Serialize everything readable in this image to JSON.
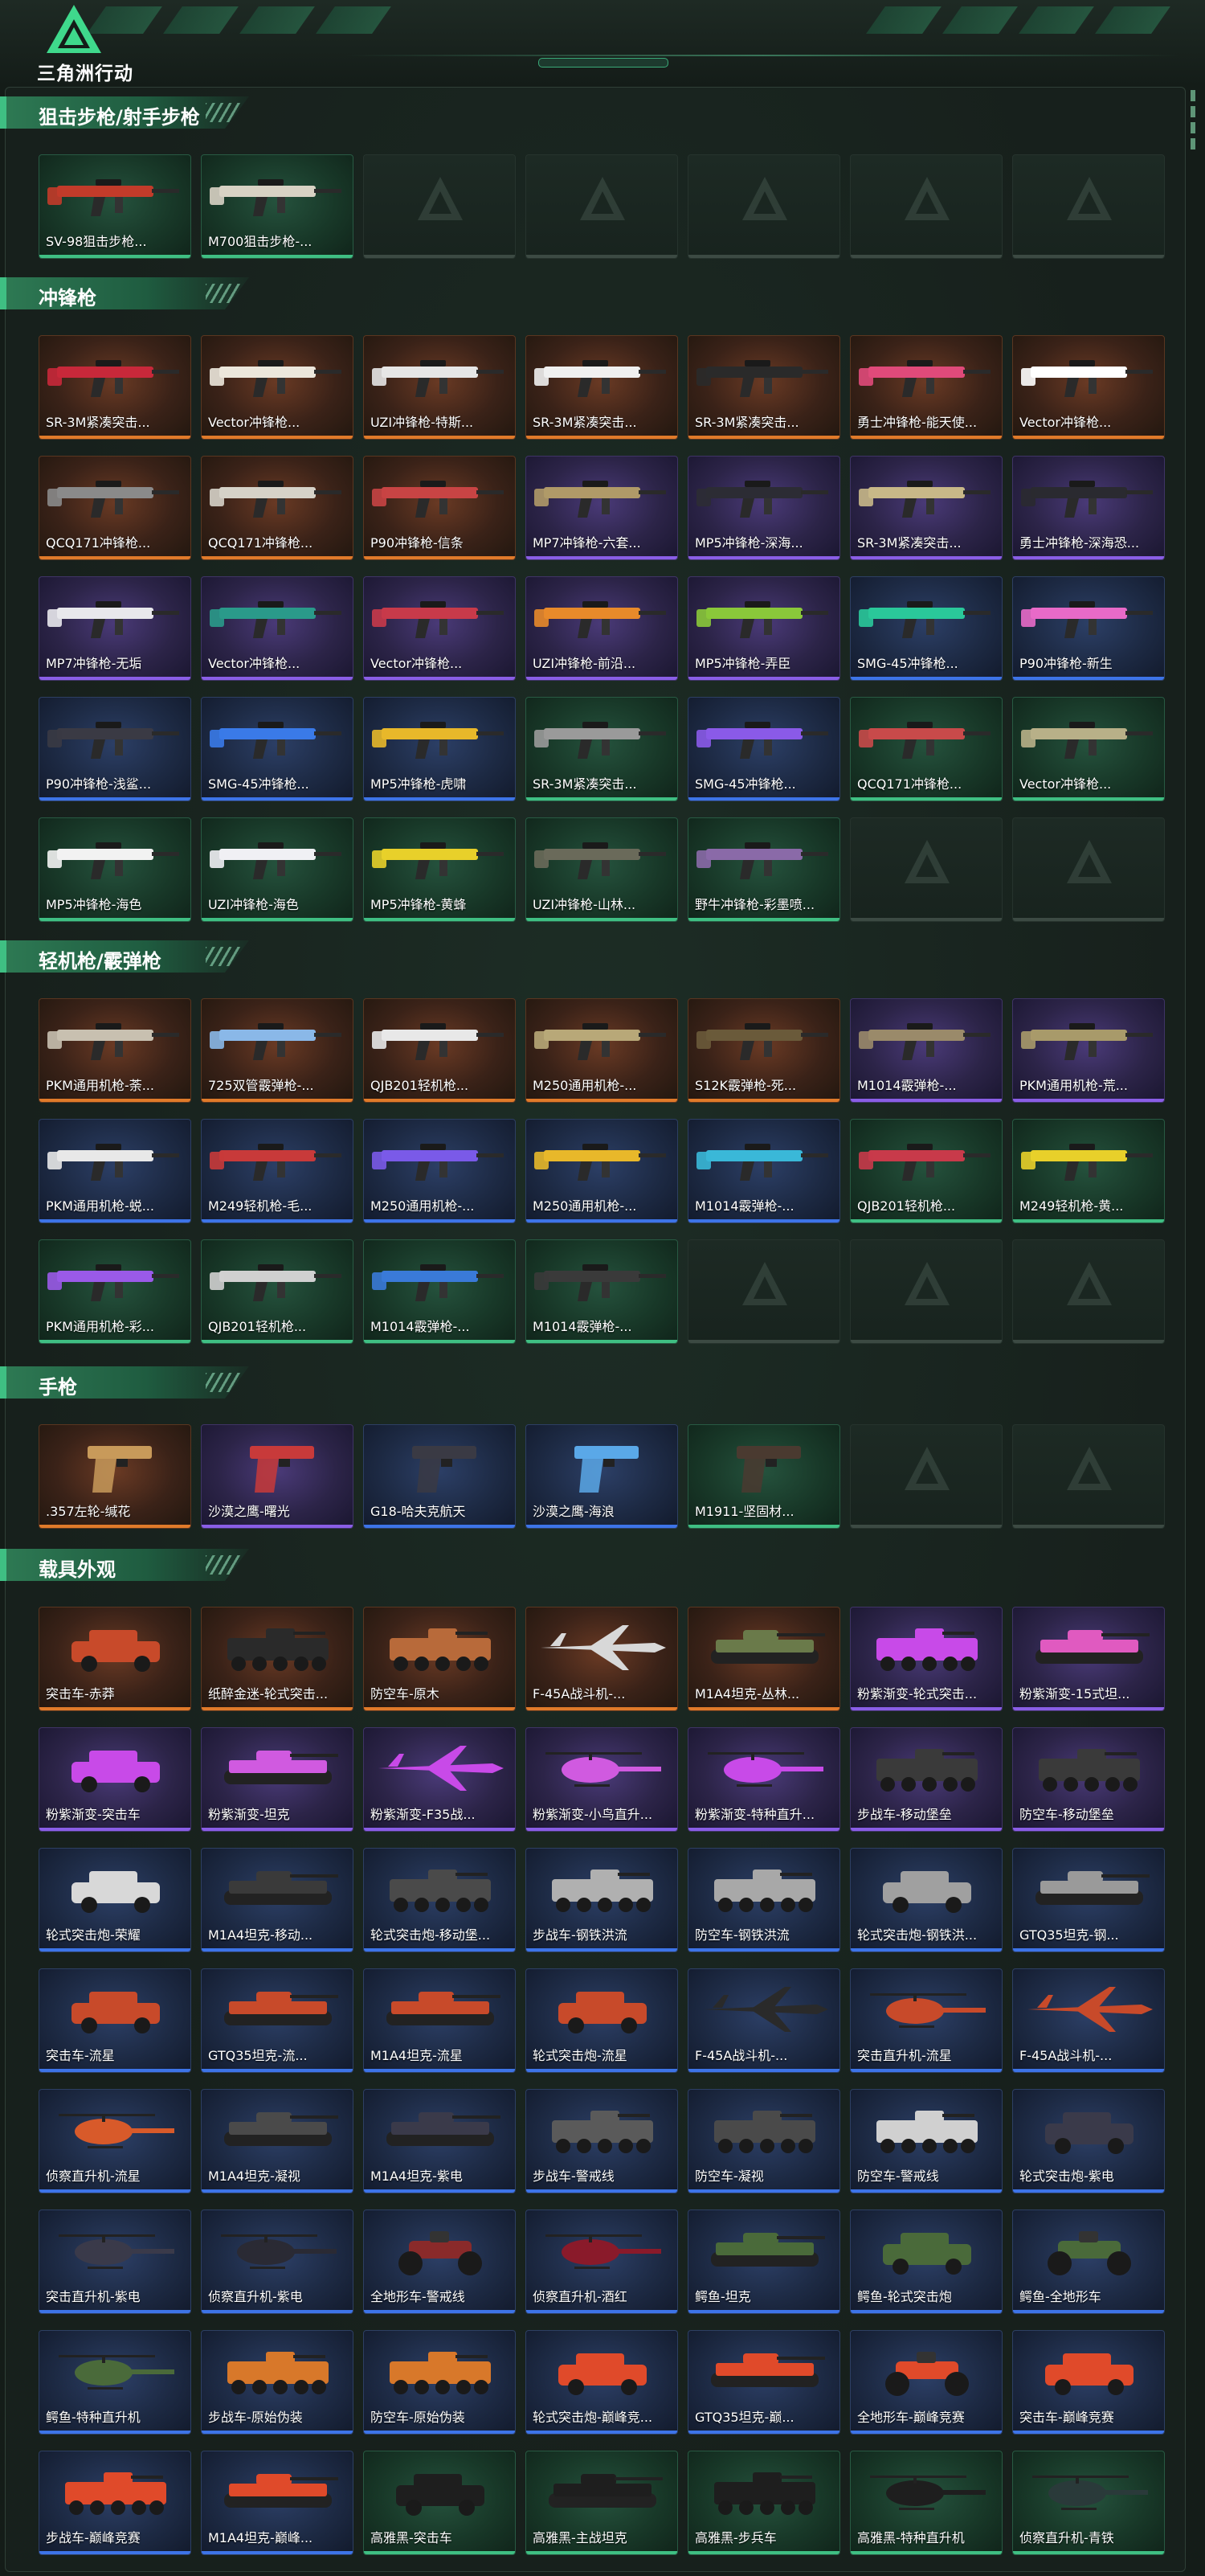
{
  "app": {
    "title": "三角洲行动"
  },
  "colors": {
    "orange": "#e07a2a",
    "purple": "#8a5ee6",
    "blue": "#3d74e8",
    "green": "#3fbf83",
    "accent": "#2e7a54",
    "background": "#141c18"
  },
  "sections": [
    {
      "title": "狙击步枪/射手步枪",
      "kind": "gun",
      "rows": 1,
      "items": [
        {
          "name": "SV-98狙击步枪...",
          "rarity": "green",
          "color": "#c23b2a"
        },
        {
          "name": "M700狙击步枪-...",
          "rarity": "green",
          "color": "#d8d2c4"
        },
        null,
        null,
        null,
        null,
        null
      ]
    },
    {
      "title": "冲锋枪",
      "kind": "gun",
      "rows": 5,
      "items": [
        {
          "name": "SR-3M紧凑突击...",
          "rarity": "orange",
          "color": "#c8283a"
        },
        {
          "name": "Vector冲锋枪...",
          "rarity": "orange",
          "color": "#ece7dc"
        },
        {
          "name": "UZI冲锋枪-特斯...",
          "rarity": "orange",
          "color": "#e6e6e6"
        },
        {
          "name": "SR-3M紧凑突击...",
          "rarity": "orange",
          "color": "#f0f0f0"
        },
        {
          "name": "SR-3M紧凑突击...",
          "rarity": "orange",
          "color": "#2a2a2a"
        },
        {
          "name": "勇士冲锋枪-能天使...",
          "rarity": "orange",
          "color": "#e04a7a"
        },
        {
          "name": "Vector冲锋枪...",
          "rarity": "orange",
          "color": "#ffffff"
        },
        {
          "name": "QCQ171冲锋枪...",
          "rarity": "orange",
          "color": "#8a8a8a"
        },
        {
          "name": "QCQ171冲锋枪...",
          "rarity": "orange",
          "color": "#d6d2c8"
        },
        {
          "name": "P90冲锋枪-信条",
          "rarity": "orange",
          "color": "#c84444"
        },
        {
          "name": "MP7冲锋枪-六套...",
          "rarity": "purple",
          "color": "#b09a68"
        },
        {
          "name": "MP5冲锋枪-深海...",
          "rarity": "purple",
          "color": "#2c2c34"
        },
        {
          "name": "SR-3M紧凑突击...",
          "rarity": "purple",
          "color": "#c8b888"
        },
        {
          "name": "勇士冲锋枪-深海恐...",
          "rarity": "purple",
          "color": "#2a2a30"
        },
        {
          "name": "MP7冲锋枪-无垢",
          "rarity": "purple",
          "color": "#e8e8ec"
        },
        {
          "name": "Vector冲锋枪...",
          "rarity": "purple",
          "color": "#2a9a8a"
        },
        {
          "name": "Vector冲锋枪...",
          "rarity": "purple",
          "color": "#c83a4a"
        },
        {
          "name": "UZI冲锋枪-前沿...",
          "rarity": "purple",
          "color": "#e88a2a"
        },
        {
          "name": "MP5冲锋枪-弄臣",
          "rarity": "purple",
          "color": "#8ac83a"
        },
        {
          "name": "SMG-45冲锋枪...",
          "rarity": "blue",
          "color": "#2ac89a"
        },
        {
          "name": "P90冲锋枪-新生",
          "rarity": "blue",
          "color": "#e86ac8"
        },
        {
          "name": "P90冲锋枪-浅鲨...",
          "rarity": "blue",
          "color": "#3a3a44"
        },
        {
          "name": "SMG-45冲锋枪...",
          "rarity": "blue",
          "color": "#3a7ae8"
        },
        {
          "name": "MP5冲锋枪-虎啸",
          "rarity": "blue",
          "color": "#e8b82a"
        },
        {
          "name": "SR-3M紧凑突击...",
          "rarity": "green",
          "color": "#9a9a9a"
        },
        {
          "name": "SMG-45冲锋枪...",
          "rarity": "blue",
          "color": "#8a5ae8"
        },
        {
          "name": "QCQ171冲锋枪...",
          "rarity": "green",
          "color": "#c84a4a"
        },
        {
          "name": "Vector冲锋枪...",
          "rarity": "green",
          "color": "#b8b088"
        },
        {
          "name": "MP5冲锋枪-海色",
          "rarity": "green",
          "color": "#f2f2f2"
        },
        {
          "name": "UZI冲锋枪-海色",
          "rarity": "green",
          "color": "#f0f0f4"
        },
        {
          "name": "MP5冲锋枪-黄蜂",
          "rarity": "green",
          "color": "#e8d02a"
        },
        {
          "name": "UZI冲锋枪-山林...",
          "rarity": "green",
          "color": "#6a6a5a"
        },
        {
          "name": "野牛冲锋枪-彩墨喷...",
          "rarity": "green",
          "color": "#8a6aa8"
        },
        null,
        null
      ]
    },
    {
      "title": "轻机枪/霰弹枪",
      "kind": "gun",
      "rows": 3,
      "items": [
        {
          "name": "PKM通用机枪-荼...",
          "rarity": "orange",
          "color": "#c8c0b0"
        },
        {
          "name": "725双管霰弹枪-...",
          "rarity": "orange",
          "color": "#8ab8e8"
        },
        {
          "name": "QJB201轻机枪...",
          "rarity": "orange",
          "color": "#e8e8e8"
        },
        {
          "name": "M250通用机枪-...",
          "rarity": "orange",
          "color": "#b8a878"
        },
        {
          "name": "S12K霰弹枪-死...",
          "rarity": "orange",
          "color": "#6a5a3a"
        },
        {
          "name": "M1014霰弹枪-...",
          "rarity": "purple",
          "color": "#9a8a6a"
        },
        {
          "name": "PKM通用机枪-荒...",
          "rarity": "purple",
          "color": "#a89a6a"
        },
        {
          "name": "PKM通用机枪-蜕...",
          "rarity": "blue",
          "color": "#e8e8e8"
        },
        {
          "name": "M249轻机枪-毛...",
          "rarity": "blue",
          "color": "#c83a3a"
        },
        {
          "name": "M250通用机枪-...",
          "rarity": "blue",
          "color": "#7a5ae8"
        },
        {
          "name": "M250通用机枪-...",
          "rarity": "blue",
          "color": "#e8b82a"
        },
        {
          "name": "M1014霰弹枪-...",
          "rarity": "blue",
          "color": "#3ab8d8"
        },
        {
          "name": "QJB201轻机枪...",
          "rarity": "green",
          "color": "#c83a4a"
        },
        {
          "name": "M249轻机枪-黄...",
          "rarity": "green",
          "color": "#e8d02a"
        },
        {
          "name": "PKM通用机枪-彩...",
          "rarity": "green",
          "color": "#9a5ae8"
        },
        {
          "name": "QJB201轻机枪...",
          "rarity": "green",
          "color": "#d0d0d0"
        },
        {
          "name": "M1014霰弹枪-...",
          "rarity": "green",
          "color": "#3a7ad8"
        },
        {
          "name": "M1014霰弹枪-...",
          "rarity": "green",
          "color": "#3a3a3a"
        },
        null,
        null,
        null
      ]
    },
    {
      "title": "手枪",
      "kind": "pistol",
      "rows": 1,
      "items": [
        {
          "name": ".357左轮-缄花",
          "rarity": "orange",
          "color": "#c89a5a"
        },
        {
          "name": "沙漠之鹰-曙光",
          "rarity": "purple",
          "color": "#c83a3a"
        },
        {
          "name": "G18-哈夫克航天",
          "rarity": "blue",
          "color": "#3a3a44"
        },
        {
          "name": "沙漠之鹰-海浪",
          "rarity": "blue",
          "color": "#5aa8e8"
        },
        {
          "name": "M1911-坚固材...",
          "rarity": "green",
          "color": "#4a3a30"
        },
        null,
        null
      ]
    },
    {
      "title": "载具外观",
      "kind": "vehicle",
      "rows": 8,
      "items": [
        {
          "name": "突击车-赤莽",
          "rarity": "orange",
          "color": "#c84a2a",
          "v": "car"
        },
        {
          "name": "纸醉金迷-轮式突击...",
          "rarity": "orange",
          "color": "#2a2a2a",
          "v": "apc"
        },
        {
          "name": "防空车-原木",
          "rarity": "orange",
          "color": "#b86a3a",
          "v": "apc"
        },
        {
          "name": "F-45A战斗机-...",
          "rarity": "orange",
          "color": "#d8d8d8",
          "v": "jet"
        },
        {
          "name": "M1A4坦克-丛林...",
          "rarity": "orange",
          "color": "#6a7a4a",
          "v": "tank"
        },
        {
          "name": "粉紫渐变-轮式突击...",
          "rarity": "purple",
          "color": "#c84ae8",
          "v": "apc"
        },
        {
          "name": "粉紫渐变-15式坦...",
          "rarity": "purple",
          "color": "#e05ac0",
          "v": "tank"
        },
        {
          "name": "粉紫渐变-突击车",
          "rarity": "purple",
          "color": "#c84ae8",
          "v": "car"
        },
        {
          "name": "粉紫渐变-坦克",
          "rarity": "purple",
          "color": "#d05ae0",
          "v": "tank"
        },
        {
          "name": "粉紫渐变-F35战...",
          "rarity": "purple",
          "color": "#c84ae8",
          "v": "jet"
        },
        {
          "name": "粉紫渐变-小鸟直升...",
          "rarity": "purple",
          "color": "#d05ae0",
          "v": "heli"
        },
        {
          "name": "粉紫渐变-特种直升...",
          "rarity": "purple",
          "color": "#c84ae8",
          "v": "heli"
        },
        {
          "name": "步战车-移动堡垒",
          "rarity": "purple",
          "color": "#3a3a3a",
          "v": "apc"
        },
        {
          "name": "防空车-移动堡垒",
          "rarity": "purple",
          "color": "#3a3a3a",
          "v": "apc"
        },
        {
          "name": "轮式突击炮-荣耀",
          "rarity": "blue",
          "color": "#d8d8d8",
          "v": "car"
        },
        {
          "name": "M1A4坦克-移动...",
          "rarity": "blue",
          "color": "#3a3a3a",
          "v": "tank"
        },
        {
          "name": "轮式突击炮-移动堡...",
          "rarity": "blue",
          "color": "#4a4a4a",
          "v": "apc"
        },
        {
          "name": "步战车-钢铁洪流",
          "rarity": "blue",
          "color": "#b0b0b0",
          "v": "apc"
        },
        {
          "name": "防空车-钢铁洪流",
          "rarity": "blue",
          "color": "#a8a8a8",
          "v": "apc"
        },
        {
          "name": "轮式突击炮-钢铁洪...",
          "rarity": "blue",
          "color": "#a0a0a0",
          "v": "car"
        },
        {
          "name": "GTQ35坦克-钢...",
          "rarity": "blue",
          "color": "#9a9a9a",
          "v": "tank"
        },
        {
          "name": "突击车-流星",
          "rarity": "blue",
          "color": "#c84a2a",
          "v": "car"
        },
        {
          "name": "GTQ35坦克-流...",
          "rarity": "blue",
          "color": "#c84a2a",
          "v": "tank"
        },
        {
          "name": "M1A4坦克-流星",
          "rarity": "blue",
          "color": "#c84a2a",
          "v": "tank"
        },
        {
          "name": "轮式突击炮-流星",
          "rarity": "blue",
          "color": "#c84a2a",
          "v": "car"
        },
        {
          "name": "F-45A战斗机-...",
          "rarity": "blue",
          "color": "#2a2a2a",
          "v": "jet"
        },
        {
          "name": "突击直升机-流星",
          "rarity": "blue",
          "color": "#c84a2a",
          "v": "heli"
        },
        {
          "name": "F-45A战斗机-...",
          "rarity": "blue",
          "color": "#c84a2a",
          "v": "jet"
        },
        {
          "name": "侦察直升机-流星",
          "rarity": "blue",
          "color": "#d85a2a",
          "v": "heli"
        },
        {
          "name": "M1A4坦克-凝视",
          "rarity": "blue",
          "color": "#4a4a4a",
          "v": "tank"
        },
        {
          "name": "M1A4坦克-紫电",
          "rarity": "blue",
          "color": "#3a3a4a",
          "v": "tank"
        },
        {
          "name": "步战车-警戒线",
          "rarity": "blue",
          "color": "#5a5a5a",
          "v": "apc"
        },
        {
          "name": "防空车-凝视",
          "rarity": "blue",
          "color": "#4a4a4a",
          "v": "apc"
        },
        {
          "name": "防空车-警戒线",
          "rarity": "blue",
          "color": "#d0d0d0",
          "v": "apc"
        },
        {
          "name": "轮式突击炮-紫电",
          "rarity": "blue",
          "color": "#3a3a4a",
          "v": "car"
        },
        {
          "name": "突击直升机-紫电",
          "rarity": "blue",
          "color": "#3a3a4a",
          "v": "heli"
        },
        {
          "name": "侦察直升机-紫电",
          "rarity": "blue",
          "color": "#2a2a34",
          "v": "heli"
        },
        {
          "name": "全地形车-警戒线",
          "rarity": "blue",
          "color": "#8a2a2a",
          "v": "atv"
        },
        {
          "name": "侦察直升机-酒红",
          "rarity": "blue",
          "color": "#8a1a2a",
          "v": "heli"
        },
        {
          "name": "鳄鱼-坦克",
          "rarity": "blue",
          "color": "#4a6a3a",
          "v": "tank"
        },
        {
          "name": "鳄鱼-轮式突击炮",
          "rarity": "blue",
          "color": "#4a6a3a",
          "v": "car"
        },
        {
          "name": "鳄鱼-全地形车",
          "rarity": "blue",
          "color": "#4a6a3a",
          "v": "atv"
        },
        {
          "name": "鳄鱼-特种直升机",
          "rarity": "blue",
          "color": "#4a6a3a",
          "v": "heli"
        },
        {
          "name": "步战车-原始伪装",
          "rarity": "blue",
          "color": "#d8782a",
          "v": "apc"
        },
        {
          "name": "防空车-原始伪装",
          "rarity": "blue",
          "color": "#d8782a",
          "v": "apc"
        },
        {
          "name": "轮式突击炮-巅峰竞...",
          "rarity": "blue",
          "color": "#e04a2a",
          "v": "car"
        },
        {
          "name": "GTQ35坦克-巅...",
          "rarity": "blue",
          "color": "#e04a2a",
          "v": "tank"
        },
        {
          "name": "全地形车-巅峰竞赛",
          "rarity": "blue",
          "color": "#e04a2a",
          "v": "atv"
        },
        {
          "name": "突击车-巅峰竞赛",
          "rarity": "blue",
          "color": "#e04a2a",
          "v": "car"
        },
        {
          "name": "步战车-巅峰竞赛",
          "rarity": "blue",
          "color": "#e04a2a",
          "v": "apc"
        },
        {
          "name": "M1A4坦克-巅峰...",
          "rarity": "blue",
          "color": "#e04a2a",
          "v": "tank"
        },
        {
          "name": "高雅黑-突击车",
          "rarity": "green",
          "color": "#1e1e1e",
          "v": "car"
        },
        {
          "name": "高雅黑-主战坦克",
          "rarity": "green",
          "color": "#1e1e1e",
          "v": "tank"
        },
        {
          "name": "高雅黑-步兵车",
          "rarity": "green",
          "color": "#1e1e1e",
          "v": "apc"
        },
        {
          "name": "高雅黑-特种直升机",
          "rarity": "green",
          "color": "#1e1e1e",
          "v": "heli"
        },
        {
          "name": "侦察直升机-青铁",
          "rarity": "green",
          "color": "#2a3a3a",
          "v": "heli"
        }
      ]
    }
  ]
}
